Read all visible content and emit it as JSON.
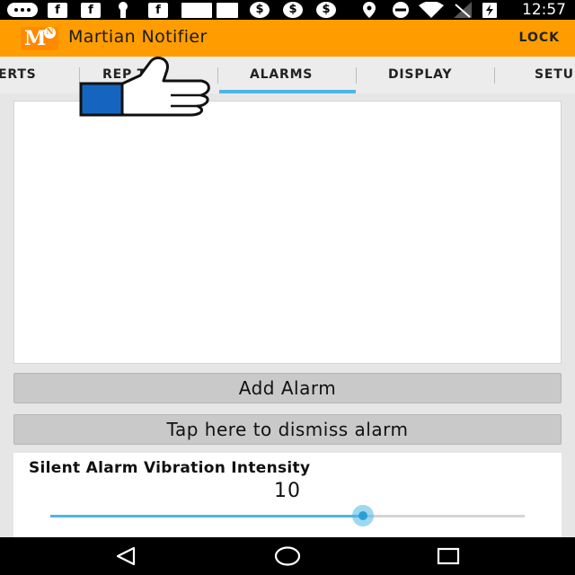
{
  "status_bar": {
    "time": "12:57",
    "notification_icons": [
      "messaging-icon",
      "facebook-icon",
      "facebook-icon",
      "keyhole-icon",
      "facebook-icon",
      "image-icon",
      "image-icon",
      "dollar-icon",
      "dollar-icon",
      "dollar-icon"
    ],
    "notif_text": {
      "f": "f",
      "dollar": "$"
    },
    "system_icons": [
      "location-icon",
      "do-not-disturb-icon",
      "wifi-icon",
      "no-signal-icon",
      "battery-charging-icon"
    ]
  },
  "app_bar": {
    "logo_letter": "M",
    "logo_sub_letter": "N",
    "title": "Martian Notifier",
    "lock_label": "LOCK",
    "color": "#ff9d00"
  },
  "tabs": {
    "items": [
      "ERTS",
      "REPEATER",
      "ALARMS",
      "DISPLAY",
      "SETU"
    ],
    "repeater_visible": "REP TER",
    "selected": "ALARMS",
    "indicator_color": "#4db6e3"
  },
  "main": {
    "add_alarm_label": "Add Alarm",
    "dismiss_label": "Tap here to dismiss alarm",
    "vibration": {
      "title": "Silent Alarm Vibration Intensity",
      "value": "10",
      "slider_fraction": 0.66
    }
  },
  "nav_bar": {
    "icons": [
      "back-icon",
      "home-icon",
      "recents-icon"
    ]
  },
  "overlay": {
    "icon": "thumbs-up-icon",
    "cuff_color": "#1565c0"
  }
}
